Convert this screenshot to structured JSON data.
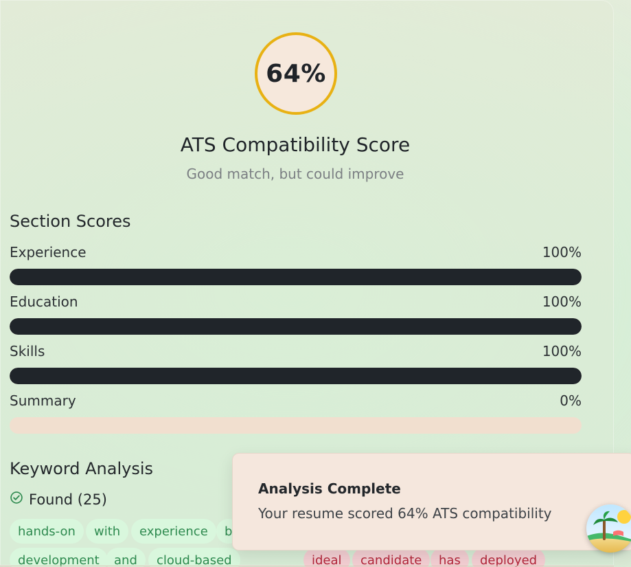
{
  "ats": {
    "score": "64%",
    "score_value": 64,
    "title": "ATS Compatibility Score",
    "subtitle": "Good match, but could improve"
  },
  "section_scores": {
    "title": "Section Scores",
    "items": [
      {
        "label": "Experience",
        "value_text": "100%",
        "value": 100
      },
      {
        "label": "Education",
        "value_text": "100%",
        "value": 100
      },
      {
        "label": "Skills",
        "value_text": "100%",
        "value": 100
      },
      {
        "label": "Summary",
        "value_text": "0%",
        "value": 0
      }
    ]
  },
  "keyword_analysis": {
    "title": "Keyword Analysis",
    "found_label": "Found (25)",
    "found_chips_row1": [
      "hands-on",
      "with",
      "experience",
      "b"
    ],
    "found_chips_row2": [
      "development",
      "and",
      "cloud-based"
    ],
    "missing_chips_visible": [
      "ideal",
      "candidate",
      "has",
      "deployed"
    ]
  },
  "toast": {
    "title": "Analysis Complete",
    "message": "Your resume scored 64% ATS compatibility"
  },
  "icons": {
    "found": "check-circle-icon",
    "avatar": "palm-beach-avatar"
  },
  "colors": {
    "ring": "#e8b113",
    "bar_fill": "#20252a",
    "bar_track": "#f1dfcf",
    "chip_found_bg": "#d9f7dd",
    "chip_found_text": "#2e8a4f",
    "chip_missing_bg": "#f4cfd3",
    "chip_missing_text": "#b3263a"
  }
}
